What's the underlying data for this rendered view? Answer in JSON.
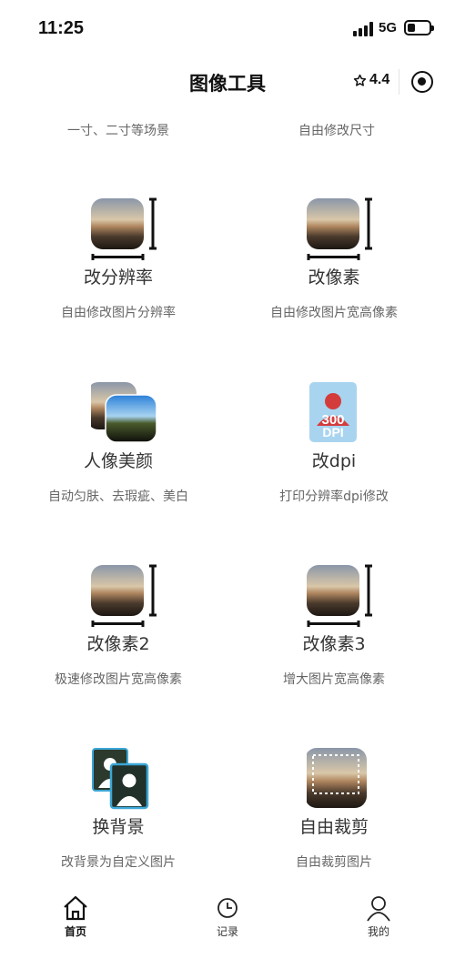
{
  "status_bar": {
    "time": "11:25",
    "network": "5G"
  },
  "nav": {
    "title": "图像工具",
    "rating": "4.4"
  },
  "top_row": [
    {
      "desc": "一寸、二寸等场景"
    },
    {
      "desc": "自由修改尺寸"
    }
  ],
  "tools": [
    {
      "name": "改分辨率",
      "desc": "自由修改图片分辨率",
      "icon": "resize-photo-icon"
    },
    {
      "name": "改像素",
      "desc": "自由修改图片宽高像素",
      "icon": "resize-photo-icon"
    },
    {
      "name": "人像美颜",
      "desc": "自动匀肤、去瑕疵、美白",
      "icon": "beauty-photos-icon"
    },
    {
      "name": "改dpi",
      "desc": "打印分辨率dpi修改",
      "icon": "dpi-icon",
      "icon_text": "300\nDPI"
    },
    {
      "name": "改像素2",
      "desc": "极速修改图片宽高像素",
      "icon": "resize-photo-icon"
    },
    {
      "name": "改像素3",
      "desc": "增大图片宽高像素",
      "icon": "resize-photo-icon"
    },
    {
      "name": "换背景",
      "desc": "改背景为自定义图片",
      "icon": "change-background-icon"
    },
    {
      "name": "自由裁剪",
      "desc": "自由裁剪图片",
      "icon": "crop-photo-icon"
    }
  ],
  "tabbar": [
    {
      "label": "首页",
      "icon": "home-icon",
      "active": true
    },
    {
      "label": "记录",
      "icon": "clock-icon",
      "active": false
    },
    {
      "label": "我的",
      "icon": "user-icon",
      "active": false
    }
  ],
  "colors": {
    "text_primary": "#111111",
    "text_secondary": "#666666",
    "tool_name": "#333333",
    "dpi_icon_bg": "#a9d4f0",
    "dpi_icon_fg": "#d43c3c"
  }
}
